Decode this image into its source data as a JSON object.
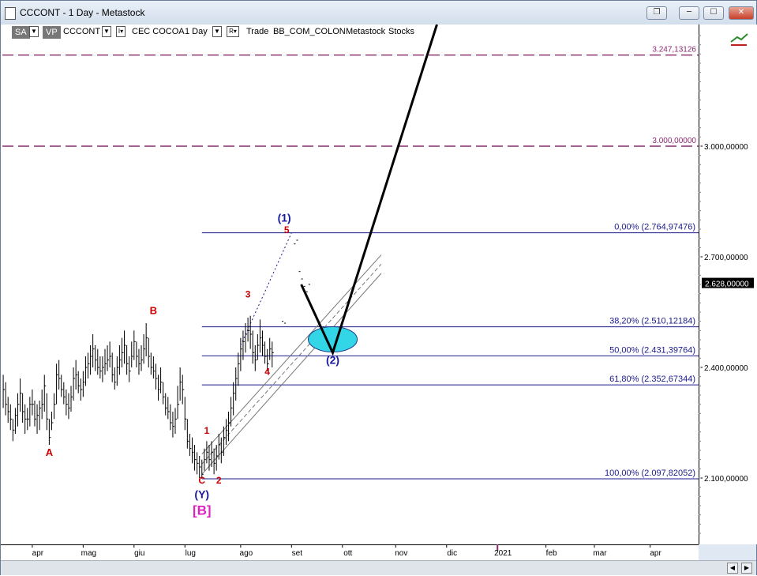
{
  "window": {
    "title": "CCCONT - 1 Day - Metastock",
    "buttons": {
      "restore_all": "❐",
      "minimize": "─",
      "maximize": "☐",
      "close": "✕"
    }
  },
  "toolbar": {
    "sa_label": "SA",
    "vp_label": "VP",
    "symbol": "CCCONT",
    "symbol_toggle": "I▾",
    "security_name": "CEC COCOA",
    "period": "1 Day",
    "r_label": "R▾",
    "trade": "Trade",
    "layout": "BB_COM_COLON",
    "source": "Metastock",
    "category": "Stocks"
  },
  "chart_data": {
    "type": "bar",
    "price_axis": {
      "ticks": [
        "3.000,00000",
        "2.700,00000",
        "2.400,00000",
        "2.100,00000"
      ],
      "tick_values": [
        3000,
        2700,
        2400,
        2100
      ],
      "last_price": "2.628,00000",
      "last_price_value": 2628,
      "range": [
        1920,
        3330
      ]
    },
    "time_axis": {
      "months": [
        "apr",
        "mag",
        "giu",
        "lug",
        "ago",
        "set",
        "ott",
        "nov",
        "dic",
        "2021",
        "feb",
        "mar",
        "apr"
      ],
      "month_index": [
        0,
        21,
        42,
        63,
        86,
        107,
        128,
        150,
        171,
        192,
        212,
        232,
        255
      ],
      "range": [
        -13,
        275
      ]
    },
    "horizontal_levels": [
      {
        "label": "3.247,13126",
        "value": 3247.13126,
        "style": "dash",
        "color": "#8b2a6e"
      },
      {
        "label": "3.000,00000",
        "value": 3000,
        "style": "dash",
        "color": "#8b2a6e"
      }
    ],
    "fibonacci": [
      {
        "label": "0,00% (2.764,97476)",
        "value": 2764.97476
      },
      {
        "label": "38,20% (2.510,12184)",
        "value": 2510.12184
      },
      {
        "label": "50,00% (2.431,39764)",
        "value": 2431.39764
      },
      {
        "label": "61,80% (2.352,67344)",
        "value": 2352.67344
      },
      {
        "label": "100,00% (2.097,82052)",
        "value": 2097.82052
      }
    ],
    "fib_start_index": 70,
    "wave_labels": [
      {
        "text": "A",
        "t": 7,
        "p": 2160,
        "color": "#cc0000",
        "size": 13
      },
      {
        "text": "B",
        "t": 50,
        "p": 2545,
        "color": "#cc0000",
        "size": 13
      },
      {
        "text": "C",
        "t": 70,
        "p": 2085,
        "color": "#cc0000",
        "size": 12
      },
      {
        "text": "(Y)",
        "t": 70,
        "p": 2045,
        "color": "#1a1aa0",
        "size": 14
      },
      {
        "text": "[B]",
        "t": 70,
        "p": 2000,
        "color": "#e020c0",
        "size": 17
      },
      {
        "text": "1",
        "t": 72,
        "p": 2220,
        "color": "#cc0000",
        "size": 12
      },
      {
        "text": "2",
        "t": 77,
        "p": 2085,
        "color": "#cc0000",
        "size": 12
      },
      {
        "text": "3",
        "t": 89,
        "p": 2590,
        "color": "#cc0000",
        "size": 12
      },
      {
        "text": "4",
        "t": 97,
        "p": 2380,
        "color": "#cc0000",
        "size": 12
      },
      {
        "text": "5",
        "t": 105,
        "p": 2764,
        "color": "#cc0000",
        "size": 12
      },
      {
        "text": "(1)",
        "t": 104,
        "p": 2795,
        "color": "#1a1aa0",
        "size": 14
      },
      {
        "text": "(2)",
        "t": 124,
        "p": 2410,
        "color": "#1a1aa0",
        "size": 14
      }
    ],
    "projection_path": [
      {
        "t": 111,
        "p": 2625
      },
      {
        "t": 124,
        "p": 2440
      },
      {
        "t": 167,
        "p": 3330
      }
    ],
    "target_zone": {
      "t": 124,
      "p": 2476
    },
    "wave5_dotted": [
      {
        "t": 86,
        "p": 2460
      },
      {
        "t": 107,
        "p": 2765
      }
    ],
    "channel_lines": [
      [
        {
          "t": 70,
          "p": 2165
        },
        {
          "t": 144,
          "p": 2705
        }
      ],
      [
        {
          "t": 70,
          "p": 2138
        },
        {
          "t": 144,
          "p": 2680
        }
      ],
      [
        {
          "t": 70,
          "p": 2110
        },
        {
          "t": 144,
          "p": 2655
        }
      ]
    ],
    "bars": [
      [
        -12,
        2290,
        2380,
        2340
      ],
      [
        -11,
        2270,
        2360,
        2300
      ],
      [
        -10,
        2250,
        2320,
        2280
      ],
      [
        -9,
        2230,
        2300,
        2260
      ],
      [
        -8,
        2200,
        2260,
        2230
      ],
      [
        -7,
        2220,
        2290,
        2270
      ],
      [
        -6,
        2240,
        2330,
        2300
      ],
      [
        -5,
        2280,
        2370,
        2330
      ],
      [
        -4,
        2250,
        2330,
        2280
      ],
      [
        -3,
        2220,
        2300,
        2260
      ],
      [
        -2,
        2230,
        2290,
        2260
      ],
      [
        -1,
        2240,
        2320,
        2300
      ],
      [
        0,
        2270,
        2340,
        2300
      ],
      [
        1,
        2240,
        2310,
        2260
      ],
      [
        2,
        2220,
        2300,
        2270
      ],
      [
        3,
        2230,
        2310,
        2290
      ],
      [
        4,
        2260,
        2340,
        2300
      ],
      [
        5,
        2280,
        2380,
        2350
      ],
      [
        6,
        2230,
        2330,
        2260
      ],
      [
        7,
        2190,
        2260,
        2210
      ],
      [
        8,
        2230,
        2280,
        2250
      ],
      [
        9,
        2260,
        2330,
        2300
      ],
      [
        10,
        2300,
        2410,
        2380
      ],
      [
        11,
        2340,
        2420,
        2370
      ],
      [
        12,
        2320,
        2380,
        2340
      ],
      [
        13,
        2300,
        2360,
        2320
      ],
      [
        14,
        2270,
        2340,
        2300
      ],
      [
        15,
        2260,
        2330,
        2290
      ],
      [
        16,
        2280,
        2350,
        2320
      ],
      [
        17,
        2310,
        2400,
        2370
      ],
      [
        18,
        2340,
        2420,
        2380
      ],
      [
        19,
        2330,
        2390,
        2350
      ],
      [
        20,
        2310,
        2370,
        2340
      ],
      [
        21,
        2320,
        2390,
        2360
      ],
      [
        22,
        2350,
        2430,
        2400
      ],
      [
        23,
        2370,
        2440,
        2410
      ],
      [
        24,
        2380,
        2460,
        2430
      ],
      [
        25,
        2400,
        2490,
        2450
      ],
      [
        26,
        2390,
        2460,
        2420
      ],
      [
        27,
        2380,
        2450,
        2400
      ],
      [
        28,
        2370,
        2430,
        2390
      ],
      [
        29,
        2360,
        2430,
        2400
      ],
      [
        30,
        2380,
        2450,
        2410
      ],
      [
        31,
        2390,
        2460,
        2420
      ],
      [
        32,
        2400,
        2470,
        2430
      ],
      [
        33,
        2360,
        2440,
        2380
      ],
      [
        34,
        2340,
        2400,
        2360
      ],
      [
        35,
        2350,
        2430,
        2400
      ],
      [
        36,
        2380,
        2460,
        2420
      ],
      [
        37,
        2400,
        2480,
        2440
      ],
      [
        38,
        2410,
        2500,
        2460
      ],
      [
        39,
        2380,
        2460,
        2410
      ],
      [
        40,
        2360,
        2430,
        2390
      ],
      [
        41,
        2400,
        2470,
        2430
      ],
      [
        42,
        2420,
        2500,
        2470
      ],
      [
        43,
        2400,
        2470,
        2430
      ],
      [
        44,
        2380,
        2450,
        2410
      ],
      [
        45,
        2390,
        2460,
        2420
      ],
      [
        46,
        2410,
        2490,
        2450
      ],
      [
        47,
        2430,
        2520,
        2480
      ],
      [
        48,
        2400,
        2480,
        2430
      ],
      [
        49,
        2380,
        2440,
        2400
      ],
      [
        50,
        2370,
        2430,
        2390
      ],
      [
        51,
        2340,
        2410,
        2370
      ],
      [
        52,
        2310,
        2380,
        2340
      ],
      [
        53,
        2330,
        2400,
        2360
      ],
      [
        54,
        2300,
        2360,
        2320
      ],
      [
        55,
        2270,
        2330,
        2290
      ],
      [
        56,
        2260,
        2320,
        2280
      ],
      [
        57,
        2230,
        2300,
        2250
      ],
      [
        58,
        2210,
        2280,
        2240
      ],
      [
        59,
        2220,
        2290,
        2260
      ],
      [
        60,
        2260,
        2350,
        2300
      ],
      [
        61,
        2310,
        2400,
        2360
      ],
      [
        62,
        2300,
        2380,
        2340
      ],
      [
        63,
        2230,
        2320,
        2260
      ],
      [
        64,
        2180,
        2260,
        2200
      ],
      [
        65,
        2160,
        2220,
        2180
      ],
      [
        66,
        2140,
        2210,
        2170
      ],
      [
        67,
        2120,
        2190,
        2150
      ],
      [
        68,
        2110,
        2170,
        2140
      ],
      [
        69,
        2100,
        2160,
        2130
      ],
      [
        70,
        2098,
        2150,
        2110
      ],
      [
        71,
        2120,
        2180,
        2150
      ],
      [
        72,
        2140,
        2200,
        2170
      ],
      [
        73,
        2120,
        2190,
        2150
      ],
      [
        74,
        2130,
        2200,
        2170
      ],
      [
        75,
        2110,
        2180,
        2140
      ],
      [
        76,
        2120,
        2190,
        2160
      ],
      [
        77,
        2150,
        2220,
        2190
      ],
      [
        78,
        2140,
        2210,
        2170
      ],
      [
        79,
        2160,
        2240,
        2210
      ],
      [
        80,
        2190,
        2260,
        2230
      ],
      [
        81,
        2200,
        2280,
        2250
      ],
      [
        82,
        2240,
        2320,
        2290
      ],
      [
        83,
        2270,
        2360,
        2330
      ],
      [
        84,
        2310,
        2400,
        2370
      ],
      [
        85,
        2350,
        2440,
        2410
      ],
      [
        86,
        2390,
        2480,
        2450
      ],
      [
        87,
        2420,
        2500,
        2470
      ],
      [
        88,
        2440,
        2520,
        2490
      ],
      [
        89,
        2470,
        2535,
        2500
      ],
      [
        90,
        2450,
        2540,
        2490
      ],
      [
        91,
        2410,
        2500,
        2440
      ],
      [
        92,
        2390,
        2460,
        2420
      ],
      [
        93,
        2420,
        2490,
        2460
      ],
      [
        94,
        2440,
        2530,
        2480
      ],
      [
        95,
        2430,
        2500,
        2460
      ],
      [
        96,
        2410,
        2470,
        2430
      ],
      [
        97,
        2390,
        2450,
        2410
      ],
      [
        98,
        2420,
        2480,
        2450
      ],
      [
        99,
        2400,
        2470,
        2440
      ]
    ],
    "ticks_scatter": [
      [
        103,
        2525
      ],
      [
        104,
        2520
      ],
      [
        108,
        2735
      ],
      [
        109,
        2745
      ],
      [
        110,
        2660
      ],
      [
        111,
        2640
      ],
      [
        112,
        2620
      ],
      [
        113,
        2605
      ],
      [
        114,
        2625
      ]
    ]
  }
}
